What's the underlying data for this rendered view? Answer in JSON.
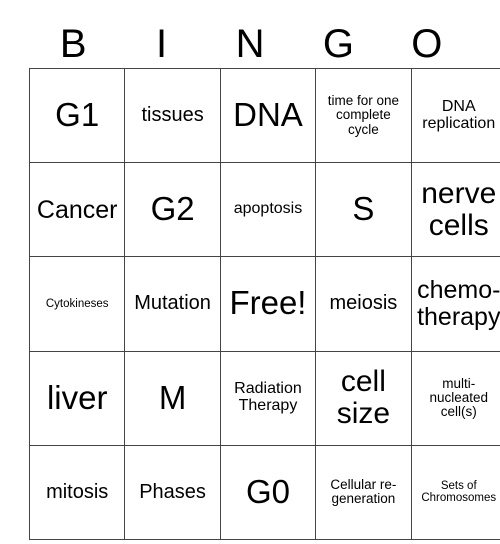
{
  "card": {
    "title": "BINGO",
    "header_letters": [
      "B",
      "I",
      "N",
      "G",
      "O"
    ],
    "free_space_label": "Free!",
    "colors": {
      "text": "#000000",
      "grid_line": "#444444",
      "background": "#ffffff"
    },
    "grid_size": "5x5",
    "rows": [
      {
        "cells": [
          {
            "text": "G1",
            "size": "xxl"
          },
          {
            "text": "tissues",
            "size": "md"
          },
          {
            "text": "DNA",
            "size": "xxl"
          },
          {
            "text": "time for one complete cycle",
            "size": "xs"
          },
          {
            "text": "DNA replication",
            "size": "sm"
          }
        ]
      },
      {
        "cells": [
          {
            "text": "Cancer",
            "size": "lg"
          },
          {
            "text": "G2",
            "size": "xxl"
          },
          {
            "text": "apoptosis",
            "size": "sm"
          },
          {
            "text": "S",
            "size": "xxl"
          },
          {
            "text": "nerve cells",
            "size": "xl"
          }
        ]
      },
      {
        "cells": [
          {
            "text": "Cytokineses",
            "size": "xxs"
          },
          {
            "text": "Mutation",
            "size": "md"
          },
          {
            "text": "Free!",
            "size": "xxl"
          },
          {
            "text": "meiosis",
            "size": "md"
          },
          {
            "text": "chemo-therapy",
            "size": "lg"
          }
        ]
      },
      {
        "cells": [
          {
            "text": "liver",
            "size": "xxl"
          },
          {
            "text": "M",
            "size": "xxl"
          },
          {
            "text": "Radiation Therapy",
            "size": "sm"
          },
          {
            "text": "cell size",
            "size": "xl"
          },
          {
            "text": "multi-nucleated cell(s)",
            "size": "xs"
          }
        ]
      },
      {
        "cells": [
          {
            "text": "mitosis",
            "size": "md"
          },
          {
            "text": "Phases",
            "size": "md"
          },
          {
            "text": "G0",
            "size": "xxl"
          },
          {
            "text": "Cellular re-generation",
            "size": "xs"
          },
          {
            "text": "Sets of Chromosomes",
            "size": "xxs"
          }
        ]
      }
    ]
  }
}
